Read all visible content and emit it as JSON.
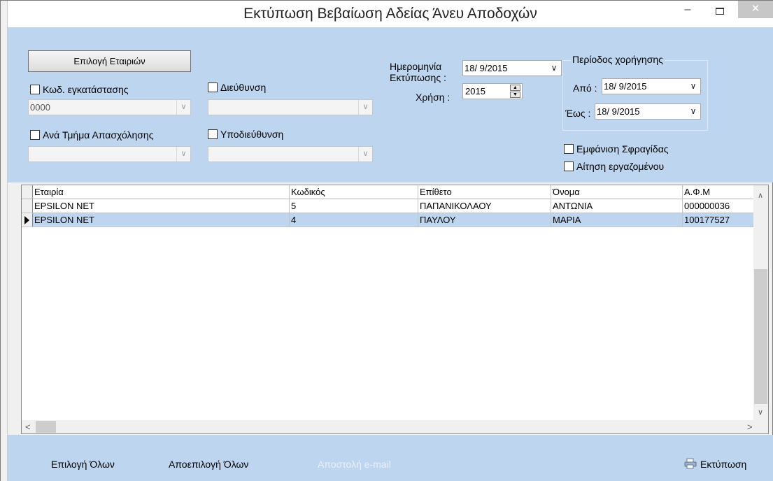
{
  "window": {
    "title": "Εκτύπωση Βεβαίωση Αδείας Άνευ Αποδοχών",
    "minimize": "–",
    "close": "✕"
  },
  "filters": {
    "select_companies": "Επιλογή Εταιριών",
    "facility_code_label": "Κωδ. εγκατάστασης",
    "facility_code_value": "0000",
    "address_label": "Διεύθυνση",
    "address_value": "",
    "department_label": "Ανά Τμήμα Απασχόλησης",
    "department_value": "",
    "subaddress_label": "Υποδιεύθυνση",
    "subaddress_value": "",
    "print_date_label_1": "Ημερομηνία",
    "print_date_label_2": "Εκτύπωσης :",
    "print_date_value": "18/  9/2015",
    "year_label": "Χρήση :",
    "year_value": "2015",
    "period_title": "Περίοδος χορήγησης",
    "from_label": "Από :",
    "from_value": "18/  9/2015",
    "to_label": "Έως :",
    "to_value": "18/  9/2015",
    "show_stamp_label": "Εμφάνιση Σφραγίδας",
    "employee_request_label": "Αίτηση εργαζομένου"
  },
  "grid": {
    "columns": [
      "Εταιρία",
      "Κωδικός",
      "Επίθετο",
      "Όνομα",
      "Α.Φ.Μ"
    ],
    "rows": [
      {
        "company": "EPSILON NET",
        "code": "5",
        "surname": "ΠΑΠΑΝΙΚΟΛΑΟΥ",
        "name": "ΑΝΤΩΝΙΑ",
        "afm": "000000036",
        "selected": false
      },
      {
        "company": "EPSILON NET",
        "code": "4",
        "surname": "ΠΑΥΛΟΥ",
        "name": "ΜΑΡΙΑ",
        "afm": "100177527",
        "selected": true
      }
    ]
  },
  "bottom": {
    "select_all": "Επιλογή Όλων",
    "deselect_all": "Αποεπιλογή Όλων",
    "send_email": "Αποστολή e-mail",
    "print": "Εκτύπωση"
  }
}
